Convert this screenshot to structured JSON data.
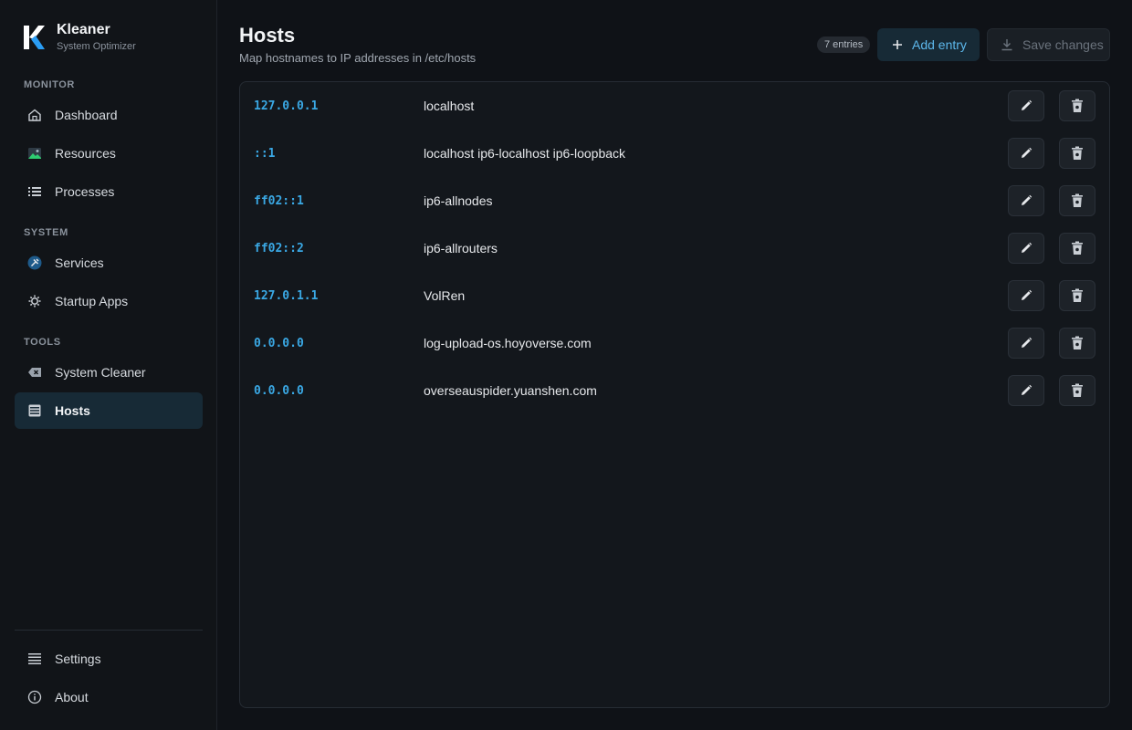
{
  "brand": {
    "name": "Kleaner",
    "subtitle": "System Optimizer"
  },
  "sidebar": {
    "sections": [
      {
        "label": "MONITOR",
        "items": [
          {
            "label": "Dashboard",
            "icon": "home-icon"
          },
          {
            "label": "Resources",
            "icon": "image-icon"
          },
          {
            "label": "Processes",
            "icon": "list-icon"
          }
        ]
      },
      {
        "label": "SYSTEM",
        "items": [
          {
            "label": "Services",
            "icon": "tools-icon"
          },
          {
            "label": "Startup Apps",
            "icon": "gear-icon"
          }
        ]
      },
      {
        "label": "TOOLS",
        "items": [
          {
            "label": "System Cleaner",
            "icon": "backspace-icon"
          },
          {
            "label": "Hosts",
            "icon": "server-icon",
            "active": true
          }
        ]
      }
    ],
    "footer": [
      {
        "label": "Settings",
        "icon": "menu-icon"
      },
      {
        "label": "About",
        "icon": "info-icon"
      }
    ]
  },
  "page": {
    "title": "Hosts",
    "subtitle": "Map hostnames to IP addresses in /etc/hosts",
    "entries_badge": "7 entries",
    "add_label": "Add entry",
    "save_label": "Save changes"
  },
  "hosts": [
    {
      "ip": "127.0.0.1",
      "hostname": "localhost"
    },
    {
      "ip": "::1",
      "hostname": "localhost ip6-localhost ip6-loopback"
    },
    {
      "ip": "ff02::1",
      "hostname": "ip6-allnodes"
    },
    {
      "ip": "ff02::2",
      "hostname": "ip6-allrouters"
    },
    {
      "ip": "127.0.1.1",
      "hostname": "VolRen"
    },
    {
      "ip": "0.0.0.0",
      "hostname": "log-upload-os.hoyoverse.com"
    },
    {
      "ip": "0.0.0.0",
      "hostname": "overseauspider.yuanshen.com"
    }
  ],
  "colors": {
    "accent": "#3aa8e4",
    "active_bg": "#172a36",
    "background": "#0f1217"
  }
}
